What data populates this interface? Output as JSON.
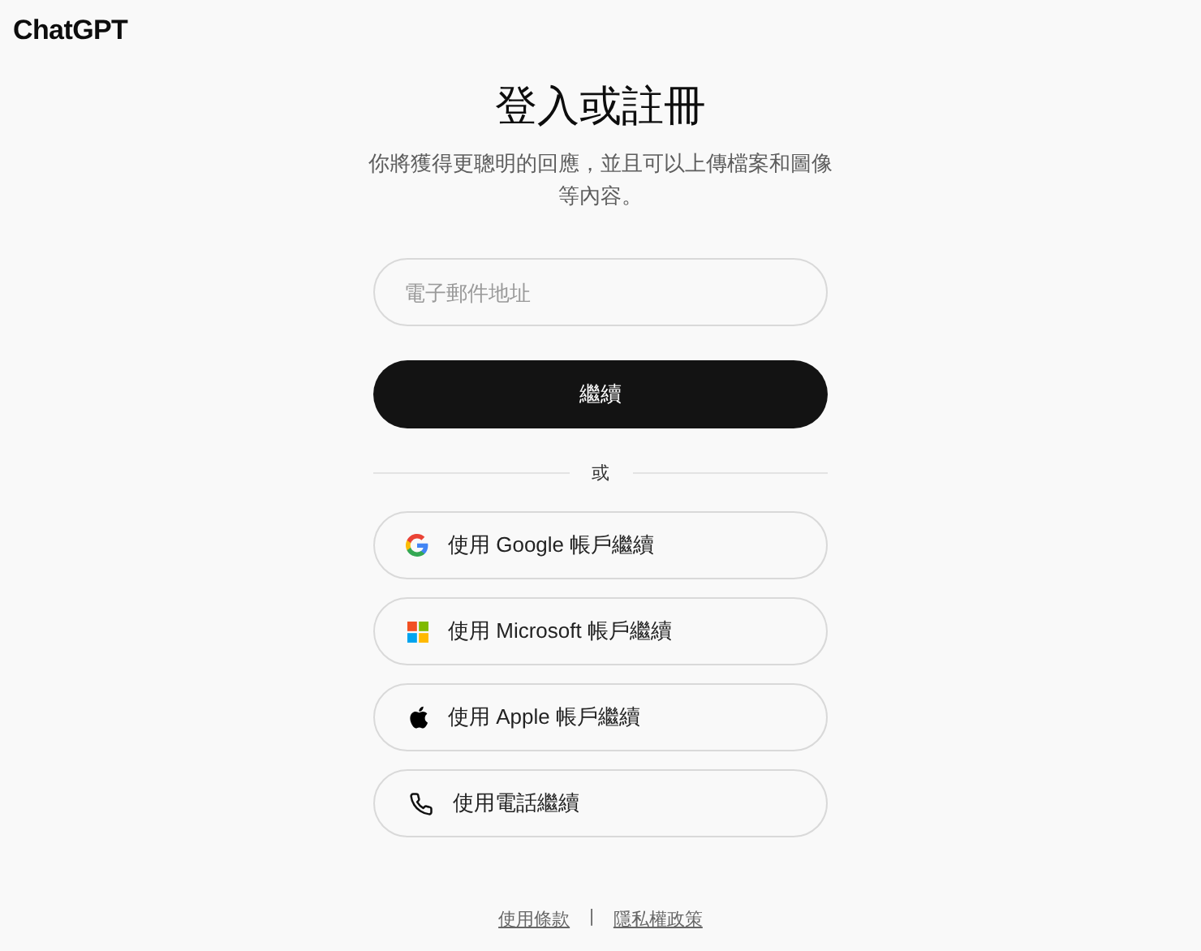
{
  "logo": "ChatGPT",
  "title": "登入或註冊",
  "subtitle": "你將獲得更聰明的回應，並且可以上傳檔案和圖像等內容。",
  "email": {
    "placeholder": "電子郵件地址"
  },
  "continue_button": "繼續",
  "divider": "或",
  "providers": [
    {
      "kind": "google",
      "label": "使用 Google 帳戶繼續"
    },
    {
      "kind": "microsoft",
      "label": "使用 Microsoft 帳戶繼續"
    },
    {
      "kind": "apple",
      "label": "使用 Apple 帳戶繼續"
    },
    {
      "kind": "phone",
      "label": "使用電話繼續"
    }
  ],
  "footer": {
    "links": [
      "使用條款",
      "隱私權政策"
    ],
    "separator": "|"
  }
}
